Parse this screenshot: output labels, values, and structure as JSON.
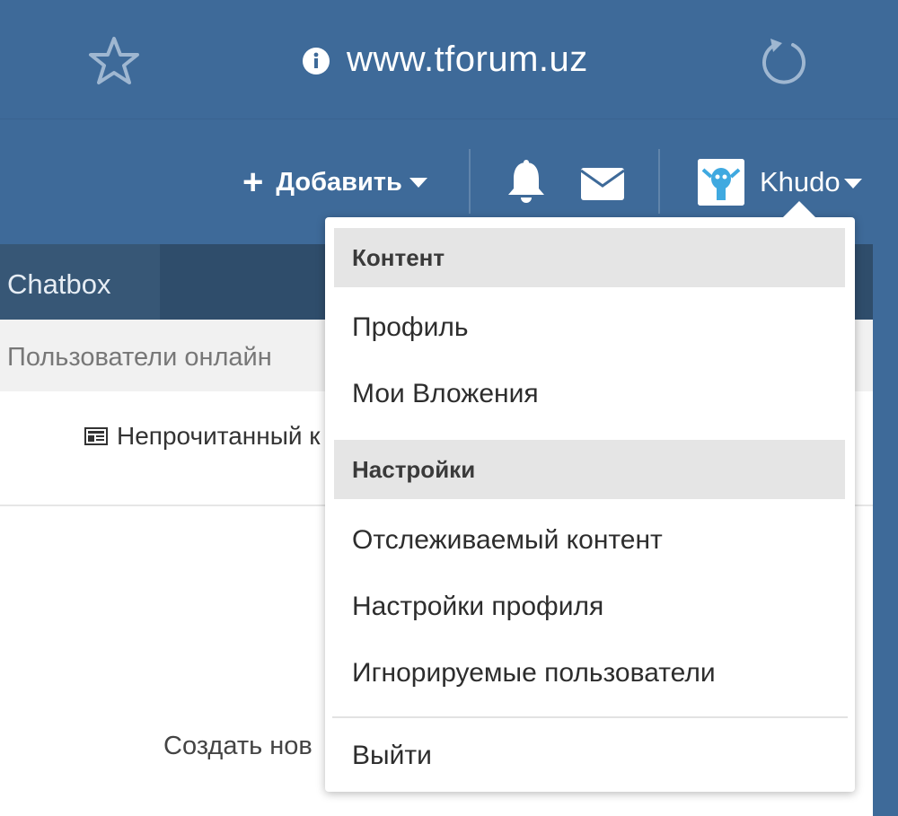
{
  "browser": {
    "url": "www.tforum.uz",
    "icons": [
      "star-icon",
      "info-icon",
      "reload-icon"
    ]
  },
  "header": {
    "add_label": "Добавить",
    "username": "Khudo",
    "icons": [
      "plus-icon",
      "bell-icon",
      "mail-icon",
      "avatar"
    ]
  },
  "nav": {
    "chatbox": "Chatbox",
    "subtitle": "Пользователи онлайн"
  },
  "content": {
    "unread": "Непрочитанный к",
    "create": "Создать нов"
  },
  "dropdown": {
    "sections": [
      {
        "heading": "Контент",
        "items": [
          "Профиль",
          "Мои Вложения"
        ]
      },
      {
        "heading": "Настройки",
        "items": [
          "Отслеживаемый контент",
          "Настройки профиля",
          "Игнорируемые пользователи"
        ]
      }
    ],
    "logout": "Выйти"
  },
  "colors": {
    "header_bg": "#3e6a99",
    "nav_bg": "#2f4d6b",
    "dropdown_heading_bg": "#e5e5e5"
  }
}
